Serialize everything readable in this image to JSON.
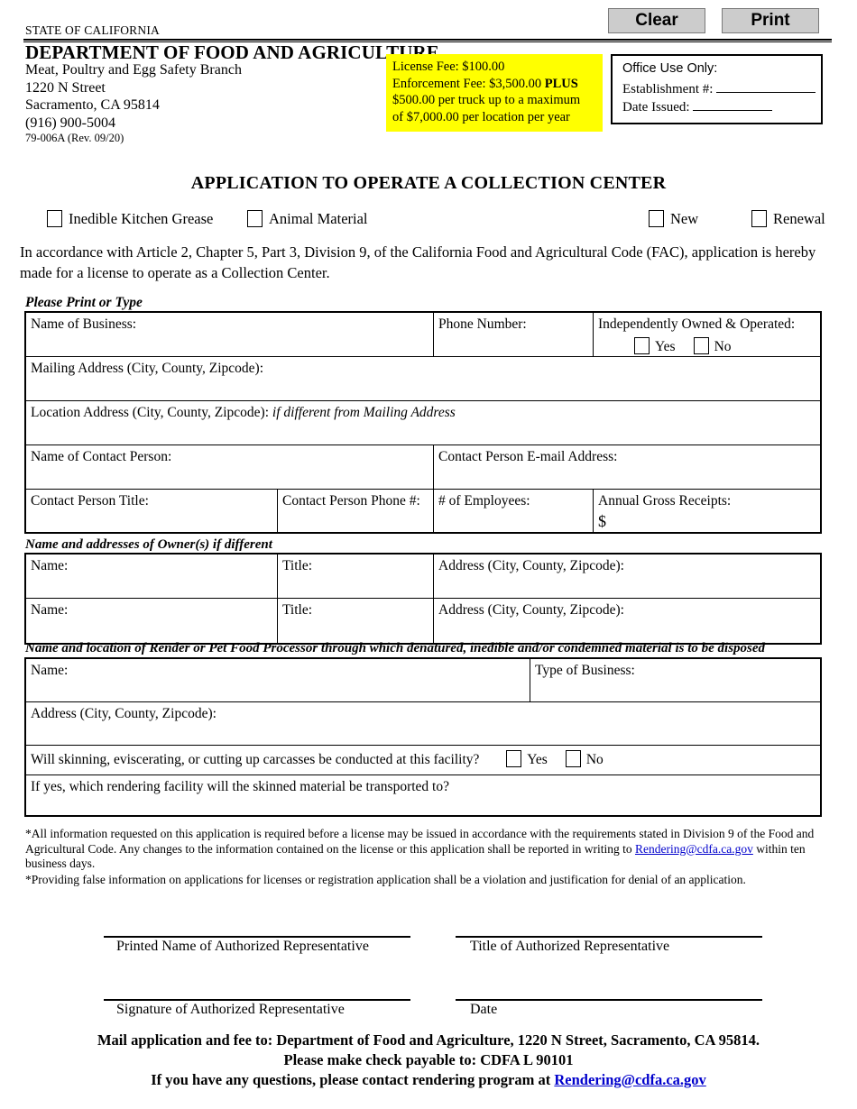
{
  "toolbar": {
    "clear_label": "Clear",
    "print_label": "Print"
  },
  "header": {
    "state_line": "STATE OF CALIFORNIA",
    "department": "DEPARTMENT OF FOOD AND AGRICULTURE",
    "branch": "Meat, Poultry and Egg Safety Branch",
    "street": "1220 N Street",
    "city_state_zip": "Sacramento, CA  95814",
    "phone": "(916) 900-5004",
    "form_number": "79-006A  (Rev. 09/20)"
  },
  "fee_box": {
    "line1": "License Fee: $100.00",
    "line2_pre": "Enforcement Fee: $3,500.00 ",
    "line2_bold": "PLUS",
    "line3": "$500.00 per truck up to a maximum",
    "line4": "of $7,000.00 per location per year",
    "background_color": "#ffff00"
  },
  "office_use": {
    "title": "Office Use Only:",
    "establishment_label": "Establishment #:",
    "date_issued_label": "Date Issued:"
  },
  "title": "APPLICATION TO OPERATE A COLLECTION CENTER",
  "type_options": [
    {
      "label": "Inedible Kitchen Grease",
      "checked": false
    },
    {
      "label": "Animal Material",
      "checked": false
    },
    {
      "label": "New",
      "checked": false
    },
    {
      "label": "Renewal",
      "checked": false
    }
  ],
  "intro": "In accordance with Article 2, Chapter 5, Part 3, Division 9, of the California Food and Agricultural Code (FAC), application is hereby made for a license to operate as a Collection Center.",
  "print_or_type": "Please Print or Type",
  "business_table": {
    "name_of_business": "Name of Business:",
    "phone_number": "Phone Number:",
    "independently_owned": "Independently Owned & Operated:",
    "yes": "Yes",
    "no": "No",
    "mailing_address": "Mailing Address (City, County, Zipcode):",
    "location_address": "Location Address (City, County, Zipcode):",
    "location_address_italic": "if different from Mailing Address",
    "contact_person": "Name of Contact Person:",
    "contact_email": "Contact Person E-mail Address:",
    "contact_title": "Contact Person Title:",
    "contact_phone": "Contact Person Phone #:",
    "employees": "# of Employees:",
    "gross_receipts": "Annual Gross Receipts:",
    "dollar_sign": "$"
  },
  "owners_section": {
    "heading": "Name and addresses of Owner(s) if different",
    "rows": [
      {
        "name": "Name:",
        "title": "Title:",
        "address": "Address (City, County, Zipcode):"
      },
      {
        "name": "Name:",
        "title": "Title:",
        "address": "Address (City, County, Zipcode):"
      }
    ]
  },
  "processor_section": {
    "heading": "Name and location of Render or Pet Food Processor through which denatured, inedible and/or condemned material is to be disposed",
    "name": "Name:",
    "type_of_business": "Type of Business:",
    "address": "Address (City, County, Zipcode):",
    "skinning_question": "Will skinning, eviscerating, or cutting up carcasses be conducted at this facility?",
    "yes": "Yes",
    "no": "No",
    "if_yes_question": "If yes, which rendering facility will the skinned material be transported to?"
  },
  "footnotes": {
    "note1_part1": "*All information requested on this application is required before a license may be issued in accordance with the requirements stated in Division 9 of the Food and Agricultural Code. Any changes to the information contained on the license or this application shall be reported in writing to ",
    "note1_email": "Rendering@cdfa.ca.gov",
    "note1_part2": " within ten business days.",
    "note2": "*Providing false information on applications for licenses or registration application shall be a violation and justification for denial of an application."
  },
  "signatures": {
    "printed_name": "Printed Name of Authorized Representative",
    "title": "Title of Authorized Representative",
    "signature": "Signature of Authorized Representative",
    "date": "Date"
  },
  "bottom": {
    "line1": "Mail application and fee to: Department of Food and Agriculture, 1220 N Street, Sacramento, CA 95814.",
    "line2": "Please make check payable to: CDFA L 90101",
    "line3_pre": "If you have any questions, please contact rendering program at ",
    "line3_email": "Rendering@cdfa.ca.gov"
  },
  "colors": {
    "highlight": "#ffff00",
    "link": "#0000cc",
    "button": "#cccccc"
  }
}
